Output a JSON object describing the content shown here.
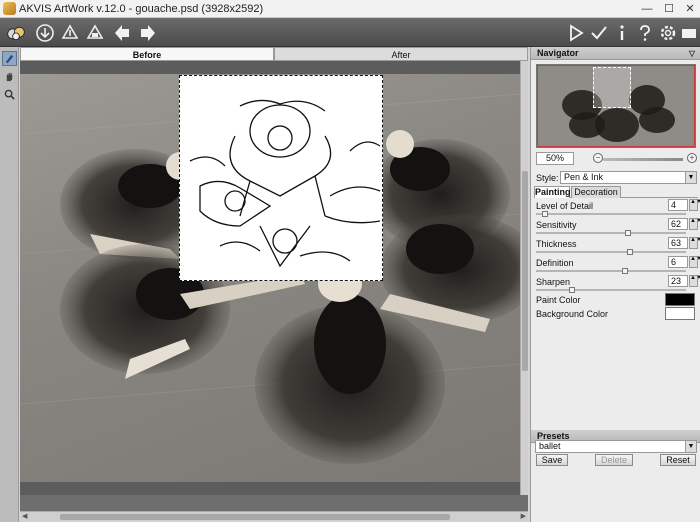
{
  "window": {
    "title": "AKVIS ArtWork v.12.0 - gouache.psd (3928x2592)",
    "minimize": "—",
    "maximize": "☐",
    "close": "✕"
  },
  "toolbar": {
    "left_icons": [
      "app-logo-icon",
      "open-icon",
      "save-icon",
      "print-icon",
      "undo-icon",
      "redo-icon"
    ],
    "right_icons": [
      "run-icon",
      "apply-icon",
      "info-icon",
      "help-icon",
      "settings-icon",
      "chat-icon"
    ]
  },
  "left_tools": [
    "brush-icon",
    "hand-icon",
    "zoom-icon"
  ],
  "view_tabs": {
    "before": "Before",
    "after": "After"
  },
  "navigator": {
    "title": "Navigator",
    "zoom": "50%",
    "zoom_out": "−",
    "zoom_in": "+"
  },
  "style": {
    "label": "Style:",
    "value": "Pen & Ink"
  },
  "param_tabs": {
    "painting": "Painting",
    "decoration": "Decoration"
  },
  "params": [
    {
      "label": "Level of Detail",
      "value": "4",
      "fraction": 0.04
    },
    {
      "label": "Sensitivity",
      "value": "62",
      "fraction": 0.62
    },
    {
      "label": "Thickness",
      "value": "63",
      "fraction": 0.63
    },
    {
      "label": "Definition",
      "value": "6",
      "fraction": 0.6
    },
    {
      "label": "Sharpen",
      "value": "23",
      "fraction": 0.23
    }
  ],
  "colors": [
    {
      "label": "Paint Color",
      "color": "#000000"
    },
    {
      "label": "Background Color",
      "color": "#ffffff"
    }
  ],
  "presets": {
    "title": "Presets",
    "value": "ballet",
    "save": "Save",
    "delete": "Delete",
    "reset": "Reset"
  }
}
